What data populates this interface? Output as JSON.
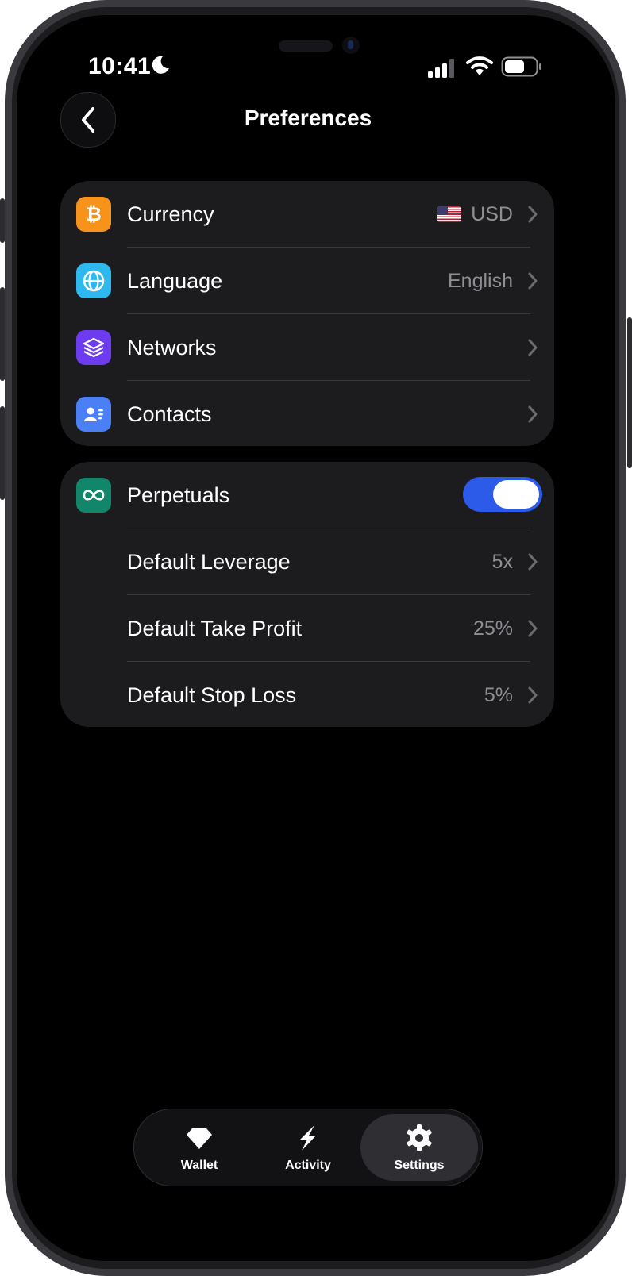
{
  "status_bar": {
    "time": "10:41",
    "moon_icon": "moon-icon",
    "signal_icon": "cellular-signal-icon",
    "wifi_icon": "wifi-icon",
    "battery_icon": "battery-icon"
  },
  "header": {
    "title": "Preferences",
    "back_icon": "chevron-left-icon"
  },
  "general": {
    "items": [
      {
        "label": "Currency",
        "value": "USD",
        "flag": "us-flag-icon",
        "icon": "bitcoin-icon",
        "icon_color": "#f7931a"
      },
      {
        "label": "Language",
        "value": "English",
        "icon": "globe-icon",
        "icon_color": "#2eb8f0"
      },
      {
        "label": "Networks",
        "value": "",
        "icon": "layers-icon",
        "icon_color": "#6e3cf0"
      },
      {
        "label": "Contacts",
        "value": "",
        "icon": "contact-card-icon",
        "icon_color": "#4a7ff5"
      }
    ]
  },
  "perpetuals": {
    "label": "Perpetuals",
    "icon": "infinity-icon",
    "icon_color": "#11866a",
    "enabled": true,
    "toggle_color": "#2c5bea",
    "items": [
      {
        "label": "Default Leverage",
        "value": "5x"
      },
      {
        "label": "Default Take Profit",
        "value": "25%"
      },
      {
        "label": "Default Stop Loss",
        "value": "5%"
      }
    ]
  },
  "tabbar": {
    "tabs": [
      {
        "label": "Wallet",
        "icon": "diamond-icon",
        "active": false
      },
      {
        "label": "Activity",
        "icon": "lightning-icon",
        "active": false
      },
      {
        "label": "Settings",
        "icon": "gear-icon",
        "active": true
      }
    ]
  }
}
